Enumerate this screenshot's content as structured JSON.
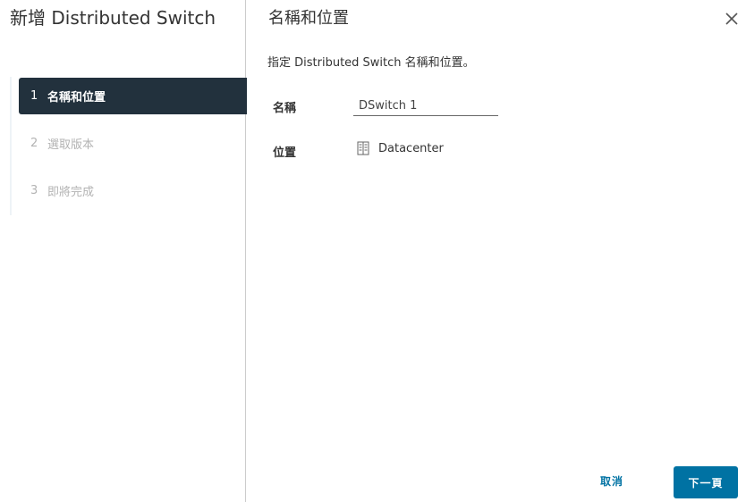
{
  "wizard": {
    "title": "新增 Distributed Switch",
    "steps": [
      {
        "number": "1",
        "label": "名稱和位置",
        "state": "active"
      },
      {
        "number": "2",
        "label": "選取版本",
        "state": "inactive"
      },
      {
        "number": "3",
        "label": "即將完成",
        "state": "inactive"
      }
    ]
  },
  "page": {
    "title": "名稱和位置",
    "description": "指定 Distributed Switch 名稱和位置。",
    "name_label": "名稱",
    "name_value": "DSwitch 1",
    "location_label": "位置",
    "location_value": "Datacenter",
    "location_icon": "datacenter-icon"
  },
  "footer": {
    "cancel_label": "取消",
    "next_label": "下一頁"
  },
  "colors": {
    "active_step_bg": "#22313d",
    "primary": "#0072a3",
    "inactive_text": "#b3b3b3"
  }
}
